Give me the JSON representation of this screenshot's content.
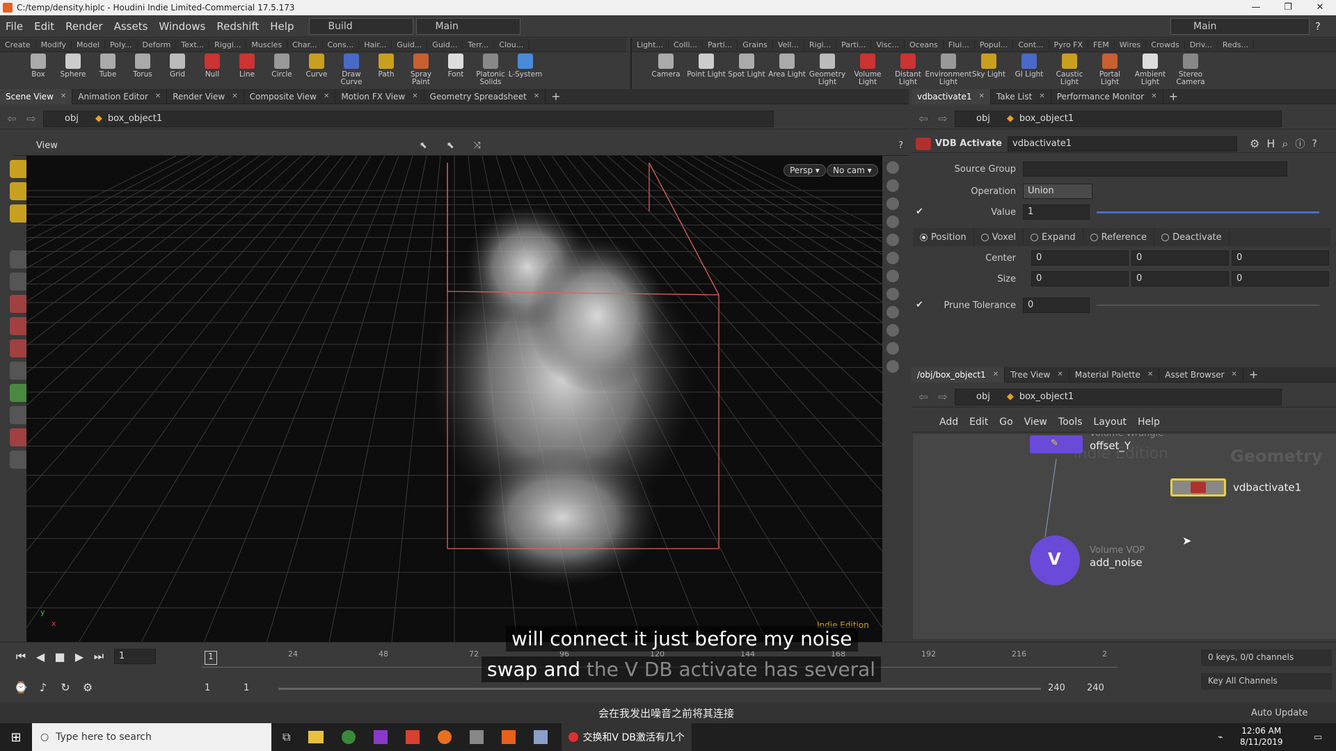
{
  "window": {
    "title": "C:/temp/density.hiplc - Houdini Indie Limited-Commercial 17.5.173",
    "controls": [
      "—",
      "❐",
      "✕"
    ]
  },
  "menu": {
    "items": [
      "File",
      "Edit",
      "Render",
      "Assets",
      "Windows",
      "Redshift",
      "Help"
    ],
    "desktop_left": "Build",
    "desktop_left2": "Main",
    "desktop_right": "Main",
    "help_icon": "?"
  },
  "shelf_left": {
    "tabs": [
      "Create",
      "Modify",
      "Model",
      "Poly...",
      "Deform",
      "Text...",
      "Riggi...",
      "Muscles",
      "Char...",
      "Cons...",
      "Hair...",
      "Guid...",
      "Guid...",
      "Terr...",
      "Clou..."
    ],
    "tools": [
      "Box",
      "Sphere",
      "Tube",
      "Torus",
      "Grid",
      "Null",
      "Line",
      "Circle",
      "Curve",
      "Draw Curve",
      "Path",
      "Spray Paint",
      "Font",
      "Platonic Solids",
      "L-System"
    ]
  },
  "shelf_right": {
    "tabs": [
      "Light...",
      "Colli...",
      "Parti...",
      "Grains",
      "Vell...",
      "Rigi...",
      "Parti...",
      "Visc...",
      "Oceans",
      "Flui...",
      "Popul...",
      "Cont...",
      "Pyro FX",
      "FEM",
      "Wires",
      "Crowds",
      "Driv...",
      "Reds..."
    ],
    "tools": [
      "Camera",
      "Point Light",
      "Spot Light",
      "Area Light",
      "Geometry Light",
      "Volume Light",
      "Distant Light",
      "Environment Light",
      "Sky Light",
      "GI Light",
      "Caustic Light",
      "Portal Light",
      "Ambient Light",
      "Stereo Camera"
    ]
  },
  "left_pane": {
    "tabs": [
      "Scene View",
      "Animation Editor",
      "Render View",
      "Composite View",
      "Motion FX View",
      "Geometry Spreadsheet"
    ],
    "path_root": "obj",
    "path_node": "box_object1",
    "view_label": "View",
    "persp": "Persp ▾",
    "cam": "No cam ▾",
    "watermark": "Indie Edition",
    "axis_x": "x",
    "axis_y": "y"
  },
  "params": {
    "tabs": [
      "vdbactivate1",
      "Take List",
      "Performance Monitor"
    ],
    "path_root": "obj",
    "path_node": "box_object1",
    "node_type": "VDB Activate",
    "node_name": "vdbactivate1",
    "source_group_label": "Source Group",
    "source_group": "",
    "operation_label": "Operation",
    "operation": "Union",
    "value_label": "Value",
    "value": "1",
    "modes": [
      "Position",
      "Voxel",
      "Expand",
      "Reference",
      "Deactivate"
    ],
    "center_label": "Center",
    "center": [
      "0",
      "0",
      "0"
    ],
    "size_label": "Size",
    "size": [
      "0",
      "0",
      "0"
    ],
    "prune_label": "Prune Tolerance",
    "prune": "0"
  },
  "network": {
    "tabs": [
      "/obj/box_object1",
      "Tree View",
      "Material Palette",
      "Asset Browser"
    ],
    "path_root": "obj",
    "path_node": "box_object1",
    "menu": [
      "Add",
      "Edit",
      "Go",
      "View",
      "Tools",
      "Layout",
      "Help"
    ],
    "context_label": "Geometry",
    "watermark": "Indie Edition",
    "nodes": [
      {
        "type": "Volume Wrangle",
        "name": "offset_Y"
      },
      {
        "type": "",
        "name": "vdbactivate1"
      },
      {
        "type": "Volume VOP",
        "name": "add_noise"
      }
    ]
  },
  "timeline": {
    "frame": "1",
    "ticks": [
      "24",
      "48",
      "72",
      "96",
      "120",
      "144",
      "168",
      "192",
      "216",
      "2"
    ],
    "range_start": "1",
    "range_start2": "1",
    "range_end": "240",
    "range_end2": "240",
    "keys": "0 keys, 0/0 channels",
    "key_all": "Key All Channels",
    "auto_update": "Auto Update",
    "current": "1"
  },
  "subtitles": {
    "line1": "will connect it just before my noise",
    "line2a": "swap and",
    "line2b": "the V DB activate has several",
    "chinese": "会在我发出噪音之前将其连接"
  },
  "taskbar": {
    "search": "Type here to search",
    "active_app": "交换和V DB激活有几个",
    "time": "12:06 AM",
    "date": "8/11/2019"
  },
  "colors": {
    "accent_node": "#e8d040",
    "noise_node": "#6a4ad8",
    "bbox": "#e06060"
  }
}
